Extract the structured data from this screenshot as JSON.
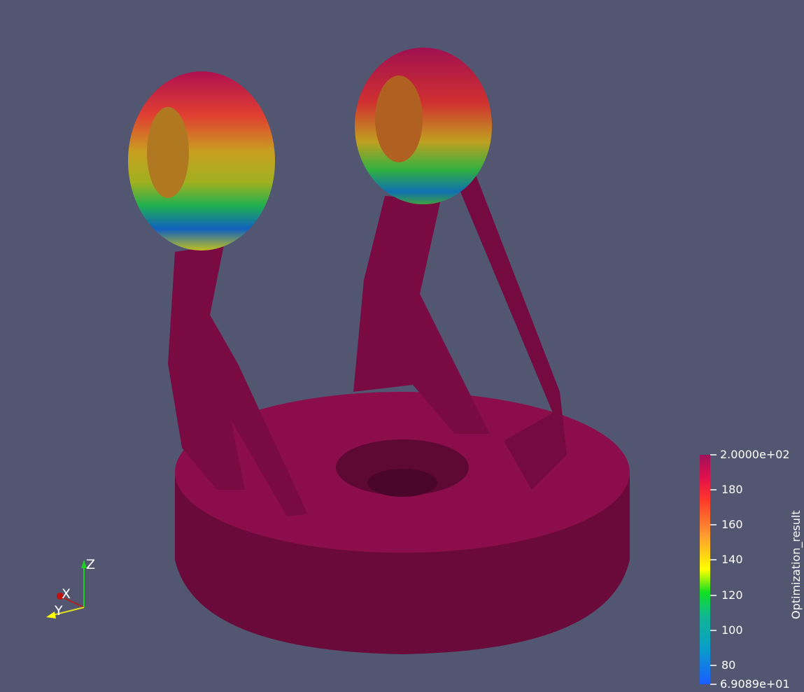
{
  "colorbar": {
    "title": "Optimization_result",
    "range": [
      69.089,
      200
    ],
    "ticks": [
      {
        "value": 200,
        "label": "2.0000e+02"
      },
      {
        "value": 180,
        "label": "180"
      },
      {
        "value": 160,
        "label": "160"
      },
      {
        "value": 140,
        "label": "140"
      },
      {
        "value": 120,
        "label": "120"
      },
      {
        "value": 100,
        "label": "100"
      },
      {
        "value": 80,
        "label": "80"
      },
      {
        "value": 69.089,
        "label": "6.9089e+01"
      }
    ],
    "colors": [
      "#1a5cff",
      "#0a9ccc",
      "#10c870",
      "#10e020",
      "#ffff00",
      "#ff9a30",
      "#ff3a2a",
      "#e0104a",
      "#a0105a"
    ]
  },
  "axes": {
    "x": "X",
    "y": "Y",
    "z": "Z"
  },
  "colors": {
    "background": "#525670",
    "part": "#8c0d4c",
    "part_shade": "#6a0a3a"
  }
}
